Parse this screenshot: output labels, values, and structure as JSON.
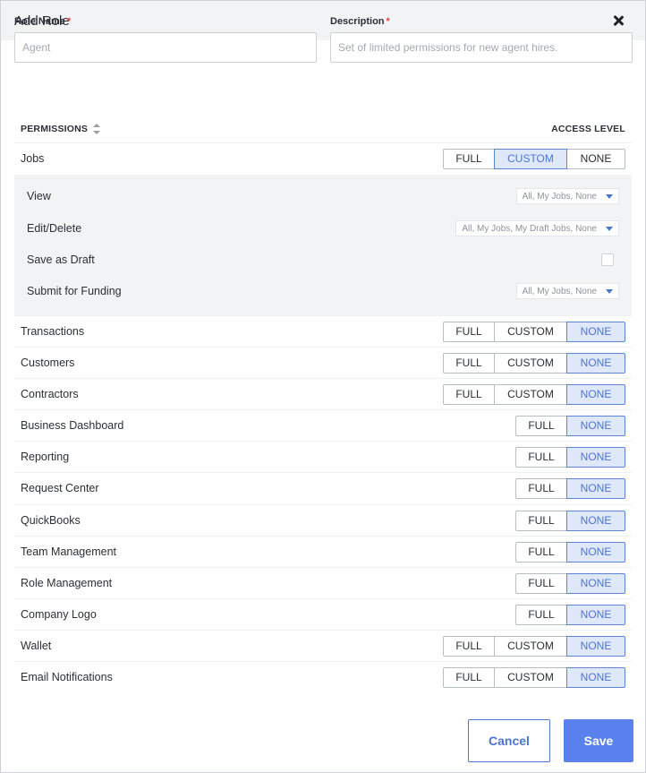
{
  "modal": {
    "title": "Add Role"
  },
  "form": {
    "role_name": {
      "label": "Role Name",
      "required": "*",
      "placeholder": "Agent",
      "value": ""
    },
    "description": {
      "label": "Description",
      "required": "*",
      "placeholder": "Set of limited permissions for new agent hires.",
      "value": ""
    }
  },
  "permissions": {
    "header_label": "PERMISSIONS",
    "access_header": "ACCESS LEVEL",
    "options": {
      "full": "FULL",
      "custom": "CUSTOM",
      "none": "NONE"
    },
    "rows": [
      {
        "label": "Jobs",
        "selected": "CUSTOM"
      },
      {
        "label": "Transactions",
        "selected": "NONE"
      },
      {
        "label": "Customers",
        "selected": "NONE"
      },
      {
        "label": "Contractors",
        "selected": "NONE"
      },
      {
        "label": "Business Dashboard",
        "selected": "NONE"
      },
      {
        "label": "Reporting",
        "selected": "NONE"
      },
      {
        "label": "Request Center",
        "selected": "NONE"
      },
      {
        "label": "QuickBooks",
        "selected": "NONE"
      },
      {
        "label": "Team Management",
        "selected": "NONE"
      },
      {
        "label": "Role Management",
        "selected": "NONE"
      },
      {
        "label": "Company Logo",
        "selected": "NONE"
      },
      {
        "label": "Wallet",
        "selected": "NONE"
      },
      {
        "label": "Email Notifications",
        "selected": "NONE"
      }
    ],
    "jobs_custom": [
      {
        "label": "View",
        "value": "All, My Jobs, None"
      },
      {
        "label": "Edit/Delete",
        "value": "All, My Jobs, My Draft Jobs, None"
      },
      {
        "label": "Save as Draft",
        "checked": false
      },
      {
        "label": "Submit for Funding",
        "value": "All, My Jobs, None"
      }
    ]
  },
  "footer": {
    "cancel_label": "Cancel",
    "save_label": "Save"
  },
  "colors": {
    "accent": "#5a82ee",
    "active_bg": "#dfe8f8",
    "required": "#e0453d",
    "panel_bg": "#f2f3f5"
  }
}
